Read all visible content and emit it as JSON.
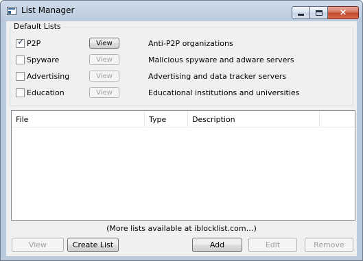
{
  "window": {
    "title": "List Manager",
    "close_glyph": "×"
  },
  "default_lists": {
    "title": "Default Lists",
    "view_label": "View",
    "items": [
      {
        "name": "P2P",
        "checked": true,
        "view_enabled": true,
        "description": "Anti-P2P organizations"
      },
      {
        "name": "Spyware",
        "checked": false,
        "view_enabled": false,
        "description": "Malicious spyware and adware servers"
      },
      {
        "name": "Advertising",
        "checked": false,
        "view_enabled": false,
        "description": "Advertising and data tracker servers"
      },
      {
        "name": "Education",
        "checked": false,
        "view_enabled": false,
        "description": "Educational institutions and universities"
      }
    ]
  },
  "list_table": {
    "columns": [
      "File",
      "Type",
      "Description"
    ],
    "rows": []
  },
  "more_lists_text": "(More lists available at iblocklist.com…)",
  "buttons": {
    "view": "View",
    "create_list": "Create List",
    "add": "Add",
    "edit": "Edit",
    "remove": "Remove"
  },
  "icons": {
    "app": "list-manager-app-icon",
    "check": "✓"
  }
}
